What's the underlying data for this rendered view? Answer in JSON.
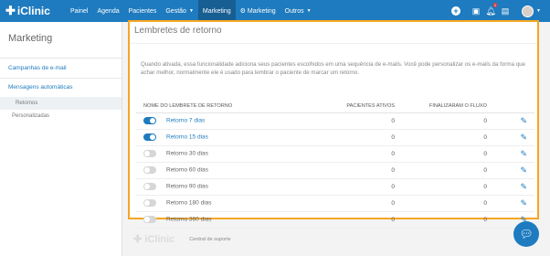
{
  "brand": {
    "name": "iClinic",
    "plus": "✚"
  },
  "nav": {
    "items": [
      {
        "label": "Painel"
      },
      {
        "label": "Agenda"
      },
      {
        "label": "Pacientes"
      },
      {
        "label": "Gestão",
        "dropdown": true
      },
      {
        "label": "Marketing",
        "active": true
      },
      {
        "label": "Marketing",
        "icon": "gear-icon"
      },
      {
        "label": "Outros",
        "dropdown": true
      }
    ],
    "notification_count": "1"
  },
  "sidebar": {
    "title": "Marketing",
    "link_email": "Campanhas de e-mail",
    "section_auto": "Mensagens automáticas",
    "sub_items": [
      {
        "label": "Retornos",
        "selected": true
      },
      {
        "label": "Personalizadas"
      }
    ]
  },
  "main": {
    "title": "Lembretes de retorno",
    "description": "Quando ativada, essa funcionalidade adiciona seus pacientes escolhidos em uma sequência de e-mails. Você pode personalizar os e-mails da forma que achar melhor, normalmente ele é usado para lembrar o paciente de marcar um retorno.",
    "table": {
      "headers": {
        "name": "NOME DO LEMBRETE DE RETORNO",
        "active": "PACIENTES ATIVOS",
        "finished": "FINALIZARAM O FLUXO"
      },
      "rows": [
        {
          "name": "Retorno 7 dias",
          "enabled": true,
          "active": "0",
          "finished": "0"
        },
        {
          "name": "Retorno 15 dias",
          "enabled": true,
          "active": "0",
          "finished": "0"
        },
        {
          "name": "Retorno 30 dias",
          "enabled": false,
          "active": "0",
          "finished": "0"
        },
        {
          "name": "Retorno 60 dias",
          "enabled": false,
          "active": "0",
          "finished": "0"
        },
        {
          "name": "Retorno 90 dias",
          "enabled": false,
          "active": "0",
          "finished": "0"
        },
        {
          "name": "Retorno 180 dias",
          "enabled": false,
          "active": "0",
          "finished": "0"
        },
        {
          "name": "Retorno 360 dias",
          "enabled": false,
          "active": "0",
          "finished": "0"
        }
      ]
    }
  },
  "footer": {
    "logo": "iClinic",
    "support": "Central de suporte"
  },
  "colors": {
    "primary": "#1e7bbf",
    "highlight": "#f5a623"
  }
}
